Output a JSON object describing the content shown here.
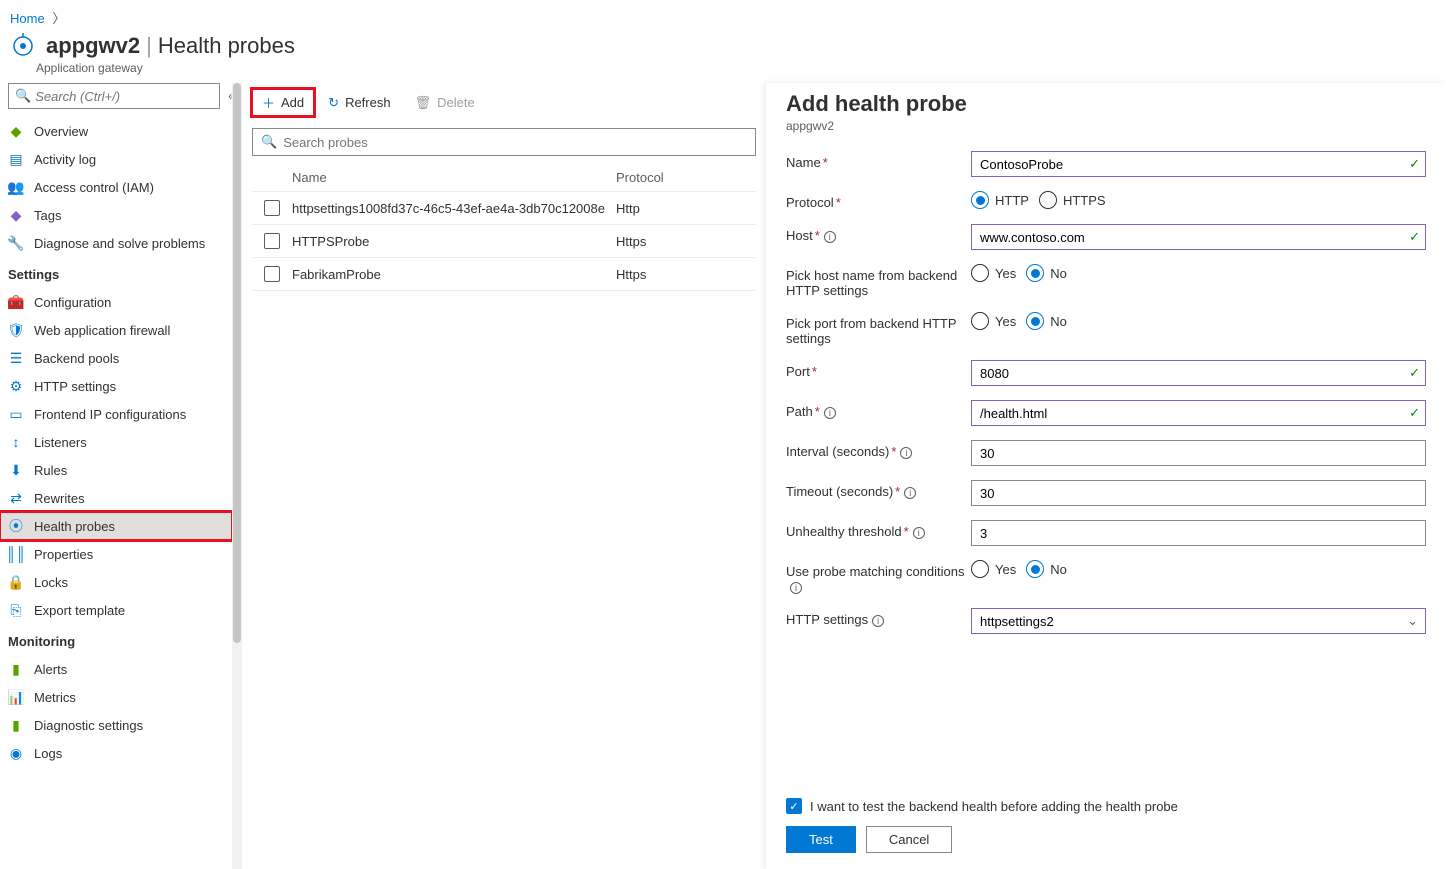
{
  "breadcrumb": {
    "home": "Home"
  },
  "header": {
    "resource": "appgwv2",
    "page": "Health probes",
    "subtitle": "Application gateway"
  },
  "search": {
    "placeholder": "Search (Ctrl+/)"
  },
  "nav": {
    "items_top": [
      {
        "label": "Overview"
      },
      {
        "label": "Activity log"
      },
      {
        "label": "Access control (IAM)"
      },
      {
        "label": "Tags"
      },
      {
        "label": "Diagnose and solve problems"
      }
    ],
    "group_settings": "Settings",
    "items_settings": [
      {
        "label": "Configuration"
      },
      {
        "label": "Web application firewall"
      },
      {
        "label": "Backend pools"
      },
      {
        "label": "HTTP settings"
      },
      {
        "label": "Frontend IP configurations"
      },
      {
        "label": "Listeners"
      },
      {
        "label": "Rules"
      },
      {
        "label": "Rewrites"
      },
      {
        "label": "Health probes"
      },
      {
        "label": "Properties"
      },
      {
        "label": "Locks"
      },
      {
        "label": "Export template"
      }
    ],
    "group_monitoring": "Monitoring",
    "items_monitoring": [
      {
        "label": "Alerts"
      },
      {
        "label": "Metrics"
      },
      {
        "label": "Diagnostic settings"
      },
      {
        "label": "Logs"
      }
    ]
  },
  "toolbar": {
    "add": "Add",
    "refresh": "Refresh",
    "delete": "Delete"
  },
  "probe_search": {
    "placeholder": "Search probes"
  },
  "table": {
    "col_name": "Name",
    "col_protocol": "Protocol",
    "rows": [
      {
        "name": "httpsettings1008fd37c-46c5-43ef-ae4a-3db70c12008e",
        "protocol": "Http"
      },
      {
        "name": "HTTPSProbe",
        "protocol": "Https"
      },
      {
        "name": "FabrikamProbe",
        "protocol": "Https"
      }
    ]
  },
  "panel": {
    "title": "Add health probe",
    "subtitle": "appgwv2",
    "labels": {
      "name": "Name",
      "protocol": "Protocol",
      "host": "Host",
      "pick_host": "Pick host name from backend HTTP settings",
      "pick_port": "Pick port from backend HTTP settings",
      "port": "Port",
      "path": "Path",
      "interval": "Interval (seconds)",
      "timeout": "Timeout (seconds)",
      "unhealthy": "Unhealthy threshold",
      "use_matching": "Use probe matching conditions",
      "http_settings": "HTTP settings"
    },
    "values": {
      "name": "ContosoProbe",
      "host": "www.contoso.com",
      "port": "8080",
      "path": "/health.html",
      "interval": "30",
      "timeout": "30",
      "unhealthy": "3",
      "http_settings": "httpsettings2"
    },
    "radios": {
      "http": "HTTP",
      "https": "HTTPS",
      "yes": "Yes",
      "no": "No"
    },
    "footer": {
      "checkbox": "I want to test the backend health before adding the health probe",
      "test": "Test",
      "cancel": "Cancel"
    }
  }
}
